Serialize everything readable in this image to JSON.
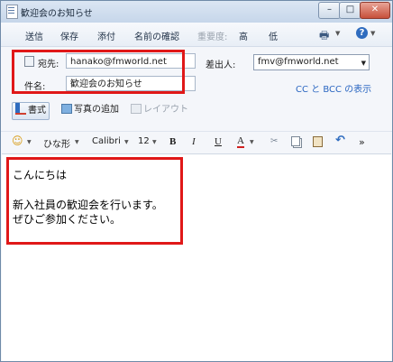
{
  "window": {
    "title": "歓迎会のお知らせ"
  },
  "menu": {
    "send": "送信",
    "save": "保存",
    "attach": "添付",
    "check_names": "名前の確認",
    "importance_label": "重要度:",
    "importance_high": "高",
    "importance_low": "低"
  },
  "header": {
    "to_label": "宛先:",
    "to_value": "hanako@fmworld.net",
    "subject_label": "件名:",
    "subject_value": "歓迎会のお知らせ",
    "from_label": "差出人:",
    "from_value": "fmv@fmworld.net",
    "cc_bcc_link": "CC と BCC の表示"
  },
  "format_row": {
    "format_label": "書式",
    "add_photo_label": "写真の追加",
    "layout_label": "レイアウト"
  },
  "toolbar": {
    "style": "ひな形",
    "font": "Calibri",
    "size": "12",
    "bold": "B",
    "italic": "I",
    "underline": "U",
    "font_color": "A",
    "more": "»"
  },
  "body": {
    "lines": [
      "こんにちは",
      "",
      "新入社員の歓迎会を行います。",
      "ぜひご参加ください。"
    ]
  },
  "colors": {
    "highlight": "#e01818",
    "link": "#2a66c1"
  }
}
